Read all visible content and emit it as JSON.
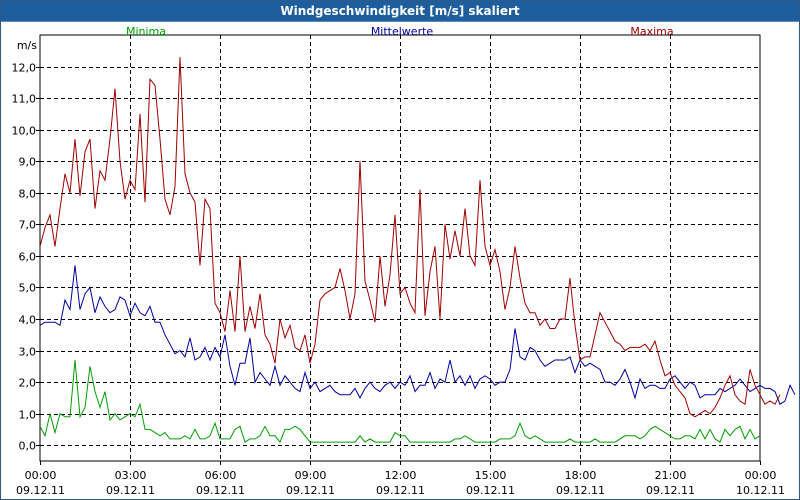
{
  "window": {
    "title": "Windgeschwindigkeit [m/s] skaliert"
  },
  "chart_data": {
    "type": "line",
    "title": "Windgeschwindigkeit [m/s] skaliert",
    "ylabel": "m/s",
    "xlabel": "",
    "xlim": [
      0,
      24
    ],
    "ylim": [
      -0.5,
      13
    ],
    "grid": true,
    "legend": "top",
    "yticks": [
      0,
      1,
      2,
      3,
      4,
      5,
      6,
      7,
      8,
      9,
      10,
      11,
      12
    ],
    "ytick_labels": [
      "0,0",
      "1,0",
      "2,0",
      "3,0",
      "4,0",
      "5,0",
      "6,0",
      "7,0",
      "8,0",
      "9,0",
      "10,0",
      "11,0",
      "12,0"
    ],
    "xticks": [
      {
        "x": 0,
        "time": "00:00",
        "date": "09.12.11"
      },
      {
        "x": 3,
        "time": "03:00",
        "date": "09.12.11"
      },
      {
        "x": 6,
        "time": "06:00",
        "date": "09.12.11"
      },
      {
        "x": 9,
        "time": "09:00",
        "date": "09.12.11"
      },
      {
        "x": 12,
        "time": "12:00",
        "date": "09.12.11"
      },
      {
        "x": 15,
        "time": "15:00",
        "date": "09.12.11"
      },
      {
        "x": 18,
        "time": "18:00",
        "date": "09.12.11"
      },
      {
        "x": 21,
        "time": "21:00",
        "date": "09.12.11"
      },
      {
        "x": 24,
        "time": "00:00",
        "date": "10.12.11"
      }
    ],
    "x_step_hours": 0.16667,
    "series": [
      {
        "name": "Minima",
        "color": "#00a000",
        "values": [
          0.6,
          0.3,
          1.0,
          0.4,
          1.0,
          0.9,
          0.9,
          2.7,
          0.9,
          1.2,
          2.5,
          1.7,
          1.2,
          1.7,
          0.8,
          1.0,
          0.8,
          0.9,
          1.0,
          0.9,
          1.3,
          0.5,
          0.5,
          0.4,
          0.3,
          0.4,
          0.2,
          0.2,
          0.2,
          0.3,
          0.2,
          0.5,
          0.2,
          0.2,
          0.3,
          0.7,
          0.2,
          0.2,
          0.2,
          0.5,
          0.6,
          0.1,
          0.2,
          0.2,
          0.3,
          0.6,
          0.3,
          0.3,
          0.1,
          0.5,
          0.5,
          0.6,
          0.5,
          0.3,
          0.1,
          0.1,
          0.1,
          0.1,
          0.1,
          0.1,
          0.1,
          0.1,
          0.1,
          0.1,
          0.3,
          0.1,
          0.2,
          0.1,
          0.1,
          0.1,
          0.1,
          0.4,
          0.3,
          0.3,
          0.1,
          0.1,
          0.1,
          0.1,
          0.1,
          0.1,
          0.1,
          0.1,
          0.1,
          0.2,
          0.2,
          0.3,
          0.2,
          0.1,
          0.1,
          0.1,
          0.1,
          0.1,
          0.2,
          0.2,
          0.2,
          0.3,
          0.7,
          0.3,
          0.2,
          0.3,
          0.2,
          0.1,
          0.1,
          0.1,
          0.1,
          0.1,
          0.2,
          0.1,
          0.1,
          0.1,
          0.1,
          0.2,
          0.1,
          0.1,
          0.1,
          0.1,
          0.2,
          0.3,
          0.3,
          0.3,
          0.2,
          0.3,
          0.5,
          0.6,
          0.5,
          0.4,
          0.3,
          0.2,
          0.2,
          0.3,
          0.3,
          0.2,
          0.5,
          0.2,
          0.5,
          0.2,
          0.1,
          0.5,
          0.3,
          0.5,
          0.6,
          0.2,
          0.5,
          0.2,
          0.3
        ]
      },
      {
        "name": "Mittelwerte",
        "color": "#0000a0",
        "values": [
          3.8,
          3.9,
          3.9,
          3.9,
          3.8,
          4.6,
          4.3,
          5.7,
          4.3,
          4.8,
          5.0,
          4.2,
          4.7,
          4.4,
          4.2,
          4.3,
          4.7,
          4.6,
          4.1,
          4.5,
          4.2,
          4.1,
          4.4,
          3.9,
          3.9,
          3.5,
          3.2,
          2.9,
          3.0,
          2.8,
          3.4,
          2.7,
          2.8,
          3.1,
          2.7,
          3.1,
          2.8,
          3.5,
          2.5,
          1.9,
          2.6,
          2.6,
          3.4,
          2.0,
          2.3,
          2.1,
          1.9,
          2.5,
          1.9,
          2.2,
          2.0,
          1.8,
          1.7,
          2.3,
          1.8,
          2.0,
          1.7,
          1.8,
          1.9,
          1.7,
          1.6,
          1.6,
          1.6,
          1.8,
          1.5,
          1.8,
          2.0,
          1.8,
          1.7,
          1.9,
          2.0,
          1.8,
          2.0,
          1.9,
          2.2,
          1.7,
          1.9,
          1.9,
          2.3,
          1.8,
          2.1,
          2.0,
          2.7,
          2.0,
          2.2,
          1.9,
          2.2,
          1.8,
          2.1,
          2.2,
          2.1,
          1.9,
          2.0,
          2.0,
          2.4,
          3.7,
          2.8,
          2.7,
          3.1,
          3.0,
          2.7,
          2.5,
          2.6,
          2.7,
          2.7,
          2.7,
          2.8,
          2.3,
          2.7,
          2.5,
          2.6,
          2.5,
          2.4,
          2.0,
          2.0,
          1.9,
          2.1,
          2.4,
          2.0,
          1.5,
          2.1,
          1.8,
          1.9,
          1.9,
          1.8,
          1.8,
          2.1,
          2.2,
          2.0,
          1.8,
          2.0,
          1.9,
          1.5,
          1.6,
          1.6,
          1.6,
          1.8,
          1.7,
          1.8,
          1.9,
          2.1,
          1.9,
          1.7,
          1.8,
          1.9,
          1.8,
          1.8,
          1.7,
          1.3,
          1.4,
          1.9,
          1.6
        ]
      },
      {
        "name": "Maxima",
        "color": "#a00000",
        "values": [
          6.3,
          6.9,
          7.3,
          6.3,
          7.5,
          8.6,
          8.0,
          9.7,
          7.9,
          9.3,
          9.7,
          7.5,
          8.7,
          8.4,
          9.7,
          11.3,
          9.0,
          7.8,
          8.4,
          8.1,
          10.5,
          7.7,
          11.6,
          11.4,
          9.7,
          7.8,
          7.3,
          8.2,
          12.3,
          8.6,
          8.0,
          7.7,
          5.7,
          7.8,
          7.5,
          4.5,
          4.2,
          3.6,
          4.9,
          3.6,
          6.0,
          3.6,
          4.4,
          3.7,
          4.8,
          3.5,
          3.2,
          2.6,
          4.0,
          3.4,
          3.8,
          3.1,
          3.0,
          3.5,
          2.6,
          3.2,
          4.6,
          4.8,
          4.9,
          5.0,
          5.6,
          4.9,
          4.0,
          4.8,
          9.0,
          5.2,
          4.6,
          3.9,
          6.0,
          4.4,
          5.4,
          7.3,
          4.8,
          5.0,
          4.5,
          4.2,
          8.1,
          4.1,
          5.5,
          6.3,
          4.0,
          7.0,
          5.9,
          6.8,
          6.0,
          7.5,
          6.0,
          5.7,
          8.4,
          6.3,
          5.7,
          6.2,
          5.5,
          4.3,
          5.0,
          6.3,
          5.3,
          4.5,
          4.2,
          4.2,
          3.8,
          4.0,
          3.7,
          3.7,
          4.0,
          4.0,
          5.3,
          3.8,
          2.7,
          2.8,
          2.8,
          3.5,
          4.2,
          3.9,
          3.6,
          3.3,
          3.2,
          3.0,
          3.1,
          3.1,
          3.1,
          3.2,
          3.0,
          3.3,
          2.7,
          2.2,
          2.3,
          1.9,
          1.7,
          1.5,
          1.0,
          0.9,
          1.0,
          1.1,
          1.0,
          1.2,
          1.5,
          1.9,
          2.2,
          1.6,
          1.4,
          1.3,
          2.4,
          1.9,
          1.6,
          1.3,
          1.4,
          1.3,
          1.6
        ]
      }
    ]
  }
}
